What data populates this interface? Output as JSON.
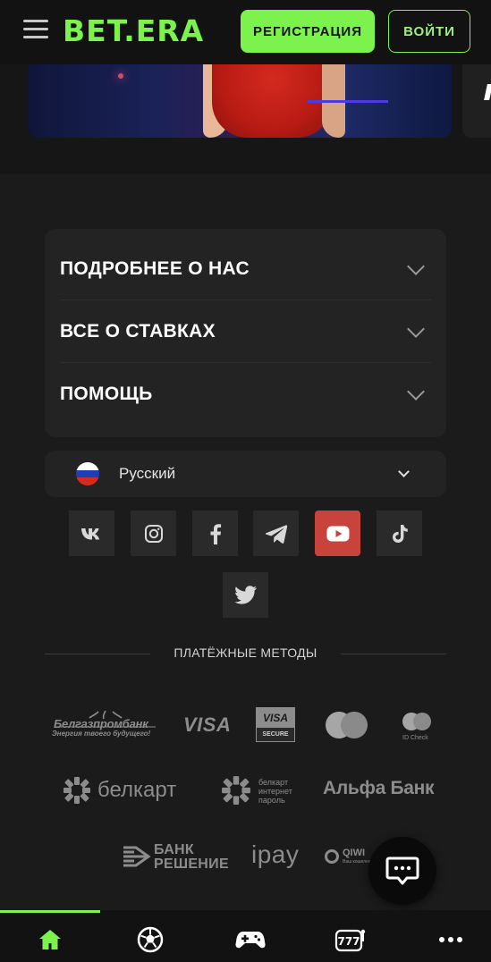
{
  "header": {
    "logo": "BET.ERA",
    "register_label": "РЕГИСТРАЦИЯ",
    "login_label": "ВОЙТИ"
  },
  "accordion": {
    "items": [
      {
        "label": "ПОДРОБНЕЕ О НАС"
      },
      {
        "label": "ВСЕ О СТАВКАХ"
      },
      {
        "label": "ПОМОЩЬ"
      }
    ]
  },
  "language": {
    "selected": "Русский"
  },
  "social": {
    "icons": [
      "vk-icon",
      "instagram-icon",
      "facebook-icon",
      "telegram-icon",
      "youtube-icon",
      "tiktok-icon",
      "twitter-icon"
    ]
  },
  "payment": {
    "title": "ПЛАТЁЖНЫЕ МЕТОДЫ",
    "belgazprom_main": "Белгазпромбанк",
    "belgazprom_sub": "Энергия твоего будущего!",
    "visa": "VISA",
    "visa_secure_top": "VISA",
    "visa_secure_bottom": "SECURE",
    "mc_idcheck": "ID Check",
    "belkart": "белкарт",
    "belkart_ip_1": "белкарт",
    "belkart_ip_2": "интернет",
    "belkart_ip_3": "пароль",
    "alfa": "Альфа Банк",
    "bank_reshenie_1": "БАНК",
    "bank_reshenie_2": "РЕШЕНИЕ",
    "ipay": "ipay",
    "qiwi": "QIWI",
    "qiwi_sub": "Ваш кошелек"
  },
  "colors": {
    "accent": "#7cf34c",
    "youtube": "#c8433c",
    "background": "#1b1b1b",
    "header": "#121212"
  },
  "bottom_nav": {
    "items": [
      "home-icon",
      "sport-ball-icon",
      "gamepad-icon",
      "slots-777-icon",
      "more-dots-icon"
    ],
    "active": "home-icon"
  }
}
